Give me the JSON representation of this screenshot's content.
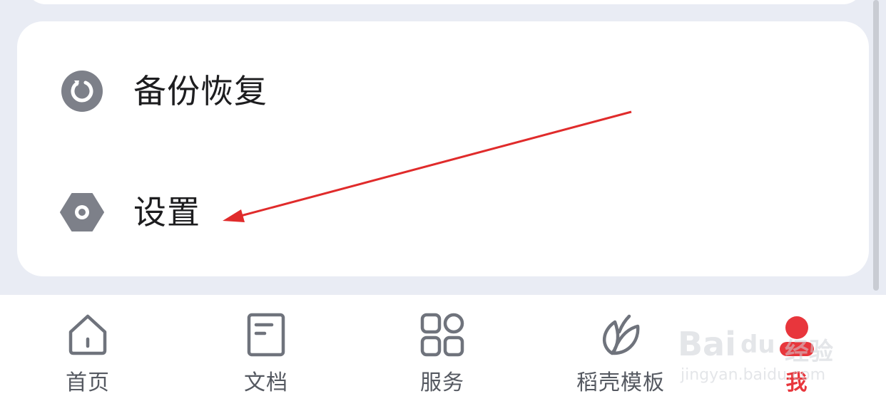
{
  "menu": {
    "items": [
      {
        "label": "备份恢复",
        "icon": "backup-restore-icon"
      },
      {
        "label": "设置",
        "icon": "settings-gear-icon"
      }
    ]
  },
  "bottom_nav": {
    "items": [
      {
        "label": "首页",
        "icon": "home-icon",
        "active": false
      },
      {
        "label": "文档",
        "icon": "document-icon",
        "active": false
      },
      {
        "label": "服务",
        "icon": "grid-apps-icon",
        "active": false
      },
      {
        "label": "稻壳模板",
        "icon": "leaf-icon",
        "active": false
      },
      {
        "label": "我",
        "icon": "profile-icon",
        "active": true
      }
    ]
  },
  "watermark": {
    "brand": "Bai",
    "brand_suffix": "du",
    "sub": "经验",
    "url": "jingyan.baidu.com"
  },
  "colors": {
    "accent": "#e8363c",
    "icon_gray": "#7d8089",
    "annotation_arrow": "#e02b2b"
  }
}
